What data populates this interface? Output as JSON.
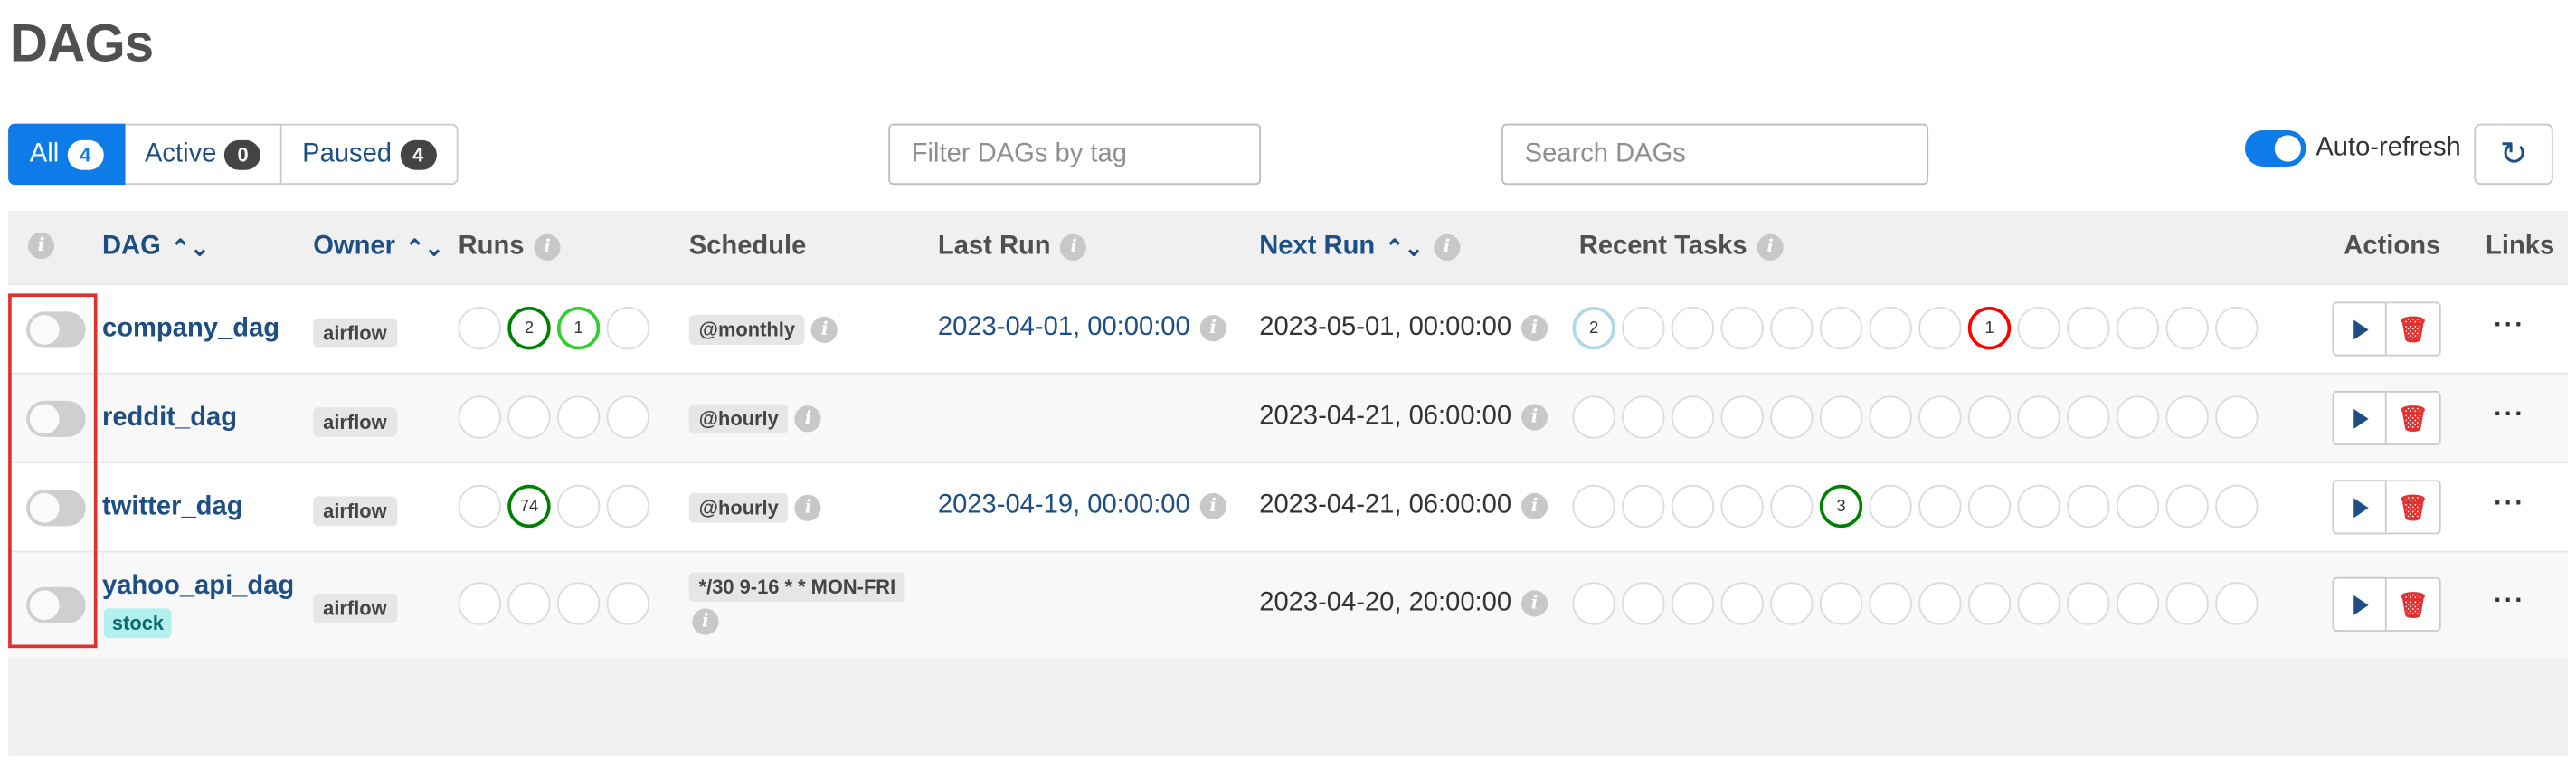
{
  "page": {
    "title": "DAGs"
  },
  "filters": [
    {
      "label": "All",
      "count": "4"
    },
    {
      "label": "Active",
      "count": "0"
    },
    {
      "label": "Paused",
      "count": "4"
    }
  ],
  "tag_filter": {
    "placeholder": "Filter DAGs by tag"
  },
  "search": {
    "placeholder": "Search DAGs"
  },
  "auto_refresh": {
    "label": "Auto-refresh",
    "enabled": true
  },
  "columns": {
    "dag": "DAG",
    "owner": "Owner",
    "runs": "Runs",
    "schedule": "Schedule",
    "last_run": "Last Run",
    "next_run": "Next Run",
    "recent_tasks": "Recent Tasks",
    "actions": "Actions",
    "links": "Links"
  },
  "dags": [
    {
      "name": "company_dag",
      "owner": "airflow",
      "schedule": "@monthly",
      "last_run": "2023-04-01, 00:00:00",
      "next_run": "2023-05-01, 00:00:00",
      "runs": [
        "",
        "2",
        "1",
        ""
      ],
      "recent_tasks": {
        "queued": "2",
        "failed": "1"
      }
    },
    {
      "name": "reddit_dag",
      "owner": "airflow",
      "schedule": "@hourly",
      "last_run": "",
      "next_run": "2023-04-21, 06:00:00",
      "runs": [
        "",
        "",
        "",
        ""
      ]
    },
    {
      "name": "twitter_dag",
      "owner": "airflow",
      "schedule": "@hourly",
      "last_run": "2023-04-19, 00:00:00",
      "next_run": "2023-04-21, 06:00:00",
      "runs": [
        "",
        "74",
        "",
        ""
      ],
      "recent_tasks": {
        "success": "3"
      }
    },
    {
      "name": "yahoo_api_dag",
      "tag": "stock",
      "owner": "airflow",
      "schedule": "*/30 9-16 * * MON-FRI",
      "last_run": "",
      "next_run": "2023-04-20, 20:00:00",
      "runs": [
        "",
        "",
        "",
        ""
      ]
    }
  ],
  "colors": {
    "success": "#008000",
    "running": "#32cd32",
    "failed": "#ff0000",
    "queued": "#add8e6",
    "link": "#1d4f84",
    "accent": "#0d7ce8",
    "highlight": "#e0312f"
  },
  "icons": {
    "sort": "sort-icon",
    "info": "info-icon",
    "refresh": "refresh-icon",
    "play": "play-icon",
    "delete": "trash-icon",
    "more": "ellipsis-icon"
  }
}
